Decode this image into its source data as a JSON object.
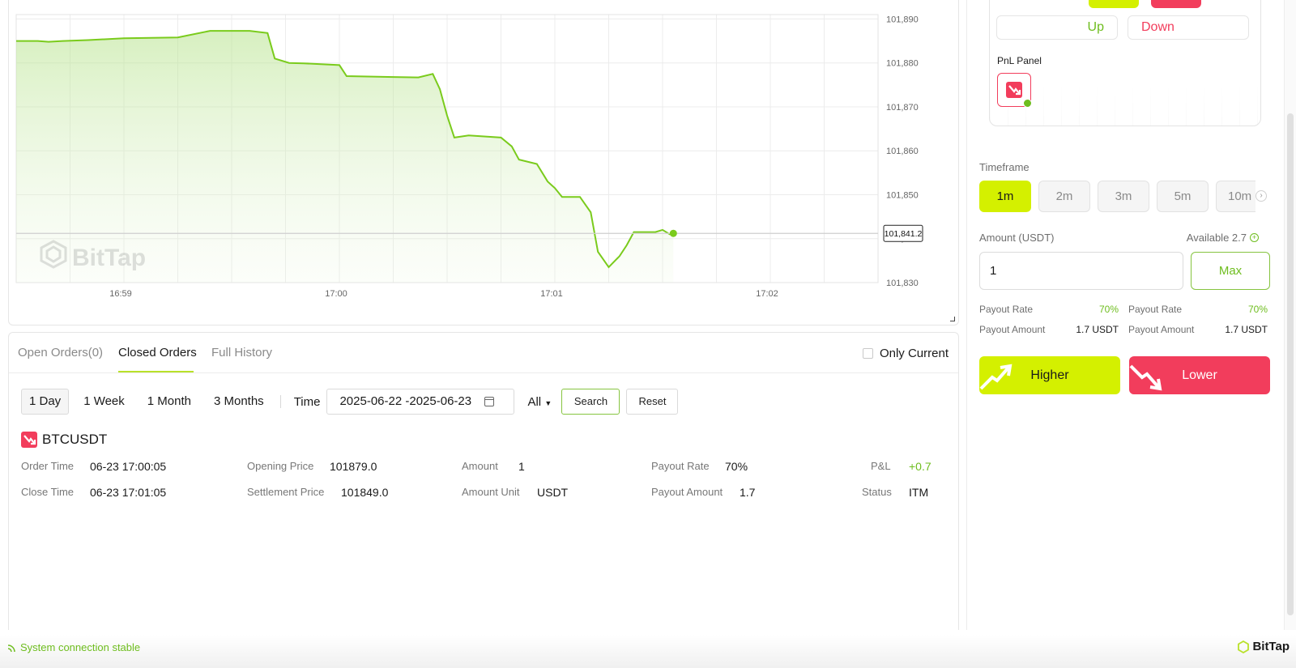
{
  "chart_data": {
    "type": "line",
    "x_ticks": [
      "16:59",
      "17:00",
      "17:01",
      "17:02"
    ],
    "y_ticks": [
      "101,890",
      "101,880",
      "101,870",
      "101,860",
      "101,850",
      "101,840",
      "101,830"
    ],
    "ylim": [
      101830,
      101891
    ],
    "current_price": 101841.2,
    "current_price_label": "101,841.2",
    "watermark": "BitTap",
    "series": [
      {
        "color": "#7acb1c",
        "points": [
          [
            0,
            101885.0
          ],
          [
            6,
            101885.0
          ],
          [
            9,
            101884.8
          ],
          [
            13,
            101885.0
          ],
          [
            20,
            101885.2
          ],
          [
            30,
            101885.6
          ],
          [
            45,
            101885.8
          ],
          [
            54,
            101887.3
          ],
          [
            65,
            101887.3
          ],
          [
            70,
            101886.8
          ],
          [
            72,
            101881.0
          ],
          [
            76,
            101880.0
          ],
          [
            80,
            101879.9
          ],
          [
            90,
            101879.5
          ],
          [
            92,
            101877.0
          ],
          [
            105,
            101876.8
          ],
          [
            112,
            101876.7
          ],
          [
            116,
            101877.5
          ],
          [
            118,
            101874.0
          ],
          [
            120,
            101868.0
          ],
          [
            122,
            101863.0
          ],
          [
            126,
            101863.5
          ],
          [
            135,
            101863.0
          ],
          [
            138,
            101861.0
          ],
          [
            140,
            101858.0
          ],
          [
            145,
            101857.0
          ],
          [
            148,
            101853.0
          ],
          [
            150,
            101851.5
          ],
          [
            152,
            101849.5
          ],
          [
            157,
            101849.5
          ],
          [
            160,
            101846.0
          ],
          [
            162,
            101837.0
          ],
          [
            165,
            101833.5
          ],
          [
            168,
            101836.0
          ],
          [
            170,
            101838.5
          ],
          [
            172,
            101841.5
          ],
          [
            178,
            101841.5
          ],
          [
            180,
            101842.0
          ],
          [
            182,
            101841.0
          ],
          [
            183,
            101841.2
          ]
        ]
      }
    ]
  },
  "orders": {
    "tabs": [
      "Open Orders(0)",
      "Closed Orders",
      "Full History"
    ],
    "only_current": "Only Current",
    "ranges": [
      "1 Day",
      "1 Week",
      "1 Month",
      "3 Months"
    ],
    "time_label": "Time",
    "date_range": "2025-06-22 -2025-06-23",
    "filter_all": "All",
    "search": "Search",
    "reset": "Reset",
    "symbol": "BTCUSDT",
    "details": {
      "order_time_label": "Order Time",
      "order_time": "06-23 17:00:05",
      "close_time_label": "Close Time",
      "close_time": "06-23 17:01:05",
      "opening_price_label": "Opening Price",
      "opening_price": "101879.0",
      "settlement_price_label": "Settlement Price",
      "settlement_price": "101849.0",
      "amount_label": "Amount",
      "amount": "1",
      "amount_unit_label": "Amount Unit",
      "amount_unit": "USDT",
      "payout_rate_label": "Payout Rate",
      "payout_rate": "70%",
      "payout_amount_label": "Payout Amount",
      "payout_amount": "1.7",
      "pnl_label": "P&L",
      "pnl": "+0.7",
      "status_label": "Status",
      "status": "ITM"
    }
  },
  "panel": {
    "up": "Up",
    "down": "Down",
    "pnl_panel": "PnL Panel",
    "timeframe_label": "Timeframe",
    "timeframes": [
      "1m",
      "2m",
      "3m",
      "5m",
      "10m"
    ],
    "amount_label": "Amount (USDT)",
    "available": "Available 2.7",
    "amount_value": "1",
    "max": "Max",
    "payout_rate_label": "Payout Rate",
    "payout_rate": "70%",
    "payout_amount_label": "Payout Amount",
    "payout_amount": "1.7 USDT",
    "higher": "Higher",
    "lower": "Lower"
  },
  "footer": {
    "status": "System connection stable",
    "brand": "BitTap"
  },
  "colors": {
    "accent_green": "#6ebd1e",
    "lime": "#d4f000",
    "red": "#f23d5c"
  }
}
